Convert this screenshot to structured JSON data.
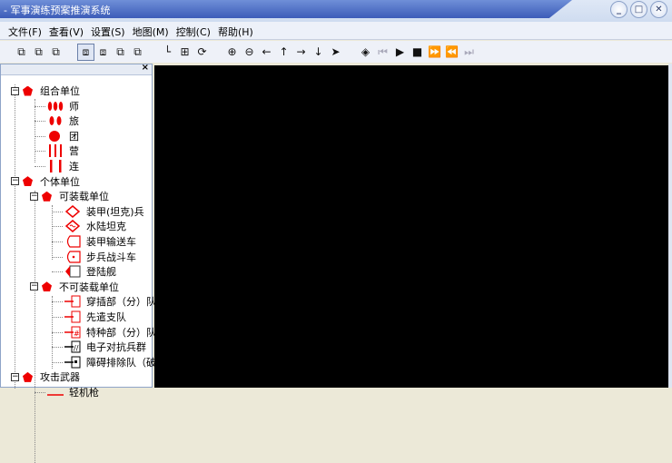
{
  "window": {
    "title": "- 军事演练预案推演系统",
    "minimize": "_",
    "maximize": "□",
    "close": "✕"
  },
  "menu": [
    "文件(F)",
    "查看(V)",
    "设置(S)",
    "地图(M)",
    "控制(C)",
    "帮助(H)"
  ],
  "toolbar": [
    {
      "name": "copy-1",
      "glyph": "⧉"
    },
    {
      "name": "copy-2",
      "glyph": "⧉"
    },
    {
      "name": "copy-3",
      "glyph": "⧉"
    },
    {
      "sep": true
    },
    {
      "name": "layer-1",
      "glyph": "⧈",
      "selected": true
    },
    {
      "name": "layer-2",
      "glyph": "⧈"
    },
    {
      "name": "layer-3",
      "glyph": "⧉"
    },
    {
      "name": "layer-4",
      "glyph": "⧉"
    },
    {
      "sep": true
    },
    {
      "name": "route",
      "glyph": "└"
    },
    {
      "name": "group",
      "glyph": "⊞"
    },
    {
      "name": "refresh",
      "glyph": "⟳"
    },
    {
      "sep": true
    },
    {
      "name": "zoom-in",
      "glyph": "⊕"
    },
    {
      "name": "zoom-out",
      "glyph": "⊖"
    },
    {
      "name": "arrow-left",
      "glyph": "←"
    },
    {
      "name": "arrow-up",
      "glyph": "↑"
    },
    {
      "name": "arrow-right",
      "glyph": "→"
    },
    {
      "name": "arrow-down",
      "glyph": "↓"
    },
    {
      "name": "pointer",
      "glyph": "➤"
    },
    {
      "sep": true
    },
    {
      "name": "waypoint",
      "glyph": "◈"
    },
    {
      "name": "first",
      "glyph": "⏮",
      "disabled": true
    },
    {
      "name": "play",
      "glyph": "▶"
    },
    {
      "name": "stop",
      "glyph": "■"
    },
    {
      "name": "fast-forward",
      "glyph": "⏩"
    },
    {
      "name": "rewind",
      "glyph": "⏪"
    },
    {
      "name": "last",
      "glyph": "⏭",
      "disabled": true
    }
  ],
  "panel": {
    "close": "×"
  },
  "tree": [
    {
      "level": 0,
      "label": "组合单位",
      "icon": "pent",
      "exp": true
    },
    {
      "level": 1,
      "label": "师",
      "icon": "three-ovals"
    },
    {
      "level": 1,
      "label": "旅",
      "icon": "two-ovals"
    },
    {
      "level": 1,
      "label": "团",
      "icon": "circle"
    },
    {
      "level": 1,
      "label": "营",
      "icon": "three-bars"
    },
    {
      "level": 1,
      "label": "连",
      "icon": "two-bars"
    },
    {
      "level": 0,
      "label": "个体单位",
      "icon": "pent",
      "exp": true
    },
    {
      "level": 1,
      "label": "可装载单位",
      "icon": "pent",
      "exp": true
    },
    {
      "level": 2,
      "label": "装甲(坦克)兵",
      "icon": "diamond"
    },
    {
      "level": 2,
      "label": "水陆坦克",
      "icon": "diamond-wave"
    },
    {
      "level": 2,
      "label": "装甲输送车",
      "icon": "rect-round"
    },
    {
      "level": 2,
      "label": "步兵战斗车",
      "icon": "rect-dot"
    },
    {
      "level": 2,
      "label": "登陆舰",
      "icon": "rect-flag"
    },
    {
      "level": 1,
      "label": "不可装载单位",
      "icon": "pent",
      "exp": true
    },
    {
      "level": 2,
      "label": "穿插部（分）队",
      "icon": "red-box"
    },
    {
      "level": 2,
      "label": "先遣支队",
      "icon": "red-box"
    },
    {
      "level": 2,
      "label": "特种部（分）队",
      "icon": "red-box-h"
    },
    {
      "level": 2,
      "label": "电子对抗兵群",
      "icon": "black-box-slash"
    },
    {
      "level": 2,
      "label": "障碍排除队（破障",
      "icon": "black-box-dot"
    },
    {
      "level": 0,
      "label": "攻击武器",
      "icon": "pent",
      "exp": true
    },
    {
      "level": 1,
      "label": "轻机枪",
      "icon": "red-line"
    }
  ],
  "colors": {
    "unit": "#e00000",
    "map": "#000000"
  }
}
